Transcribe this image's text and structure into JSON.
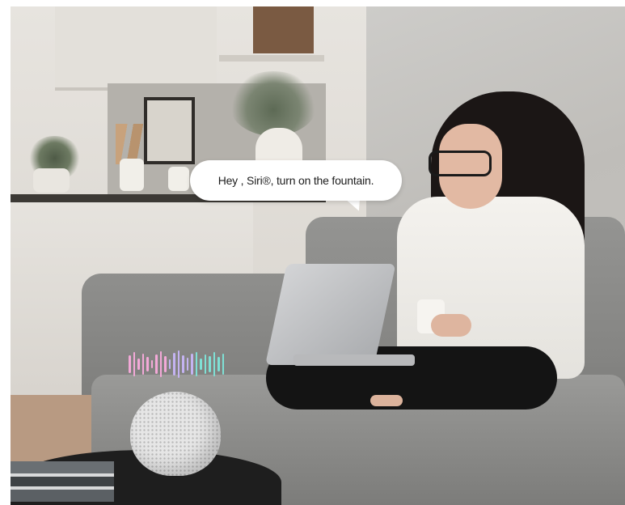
{
  "bubble": {
    "text": "Hey , Siri®, turn on the fountain."
  },
  "icons": {
    "apple_logo": ""
  },
  "colors": {
    "wave_pink": "#f3a9d8",
    "wave_violet": "#c4b3f2",
    "wave_teal": "#7fe0d5",
    "speaker": "#e6e6e6",
    "bubble_bg": "#ffffff"
  }
}
